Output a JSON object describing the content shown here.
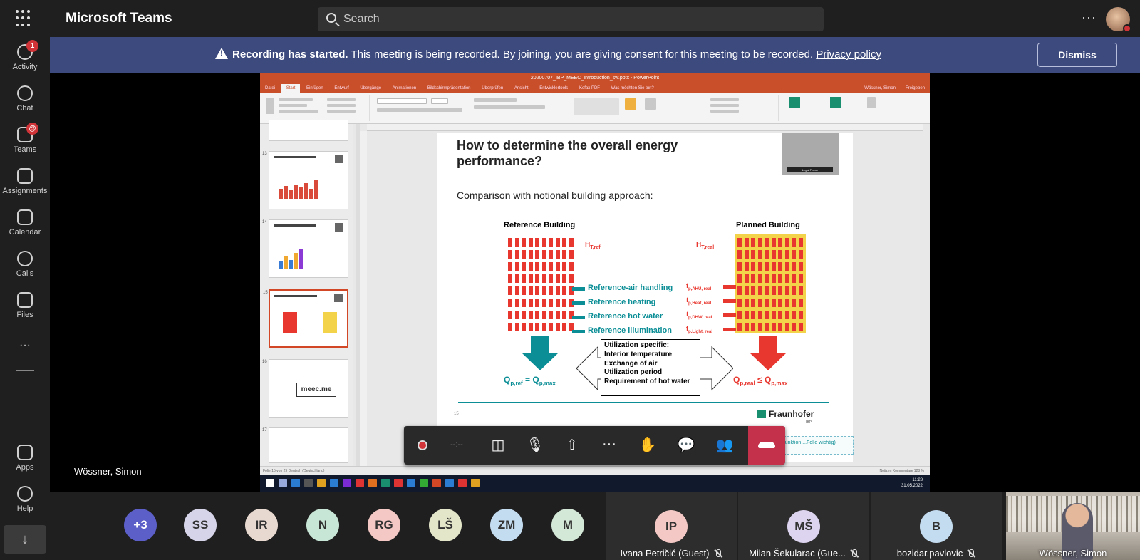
{
  "app": {
    "title": "Microsoft Teams"
  },
  "search": {
    "placeholder": "Search"
  },
  "top_right": {
    "more": "···"
  },
  "rail": {
    "items": [
      {
        "label": "Activity",
        "badge": "1",
        "icon": "bell-icon"
      },
      {
        "label": "Chat",
        "badge": "",
        "icon": "chat-icon"
      },
      {
        "label": "Teams",
        "badge": "@",
        "icon": "teams-icon"
      },
      {
        "label": "Assignments",
        "badge": "",
        "icon": "backpack-icon"
      },
      {
        "label": "Calendar",
        "badge": "",
        "icon": "calendar-icon"
      },
      {
        "label": "Calls",
        "badge": "",
        "icon": "phone-icon"
      },
      {
        "label": "Files",
        "badge": "",
        "icon": "file-icon"
      }
    ],
    "more": "···",
    "apps": "Apps",
    "help": "Help",
    "download": "↓"
  },
  "banner": {
    "bold": "Recording has started.",
    "text": " This meeting is being recorded. By joining, you are giving consent for this meeting to be recorded. ",
    "link": "Privacy policy",
    "dismiss": "Dismiss",
    "color": "#3d4a7d"
  },
  "speaker": {
    "name": "Wössner, Simon"
  },
  "ppt": {
    "window_title": "20200707_IBP_MEEC_Introduction_sw.pptx - PowerPoint",
    "tabs": [
      "Datei",
      "Start",
      "Einfügen",
      "Entwurf",
      "Übergänge",
      "Animationen",
      "Bildschirmpräsentation",
      "Überprüfen",
      "Ansicht",
      "Entwicklertools",
      "Kofax PDF",
      "Was möchten Sie tun?"
    ],
    "active_tab": "Start",
    "user": "Wössner, Simon",
    "share": "Freigeben",
    "thumb_numbers": [
      "13",
      "14",
      "15",
      "16",
      "17"
    ],
    "thumb_16_text": "meec.me",
    "slide": {
      "title": "How to determine the overall energy performance?",
      "subtitle": "Comparison with notional building approach:",
      "reference_label": "Reference Building",
      "planned_label": "Planned Building",
      "h_ref": "H",
      "h_ref_sub": "T,ref",
      "h_real": "H",
      "h_real_sub": "T,real",
      "ref_items": [
        "Reference-air handling",
        "Reference heating",
        "Reference  hot water",
        "Reference illumination"
      ],
      "f_items": [
        {
          "main": "f",
          "sub": "p,AHU, real"
        },
        {
          "main": "f",
          "sub": "p,Heat, real"
        },
        {
          "main": "f",
          "sub": "p,DHW, real"
        },
        {
          "main": "f",
          "sub": "p,Light, real"
        }
      ],
      "util_title": "Utilization specific:",
      "util_lines": [
        "Interior temperature",
        "Exchange of air",
        "Utilization period",
        "Requirement of hot water"
      ],
      "q_ref": "Q",
      "q_ref_sub": "p,ref",
      "q_ref_eq": " = Q",
      "q_ref_max": "p,max",
      "q_real": "Q",
      "q_real_sub": "p,real",
      "q_real_le": " ≤ Q",
      "q_real_max": "p,max",
      "page": "15",
      "logo": "Fraunhofer",
      "logo_sub": "IBP",
      "legal_cap": "Legal Frame"
    },
    "notes": "...d löschen (ist für die Funktion ...Folie wichtig)",
    "status": "Folie 15 von 29    Deutsch (Deutschland)",
    "status_right": "Notizen   Kommentare   128 %",
    "clock_time": "11:28",
    "clock_date": "31.05.2022"
  },
  "controls": {
    "timer": "--:--",
    "items": [
      {
        "name": "camera-off",
        "glyph": "◫"
      },
      {
        "name": "mic-off",
        "glyph": "🎙"
      },
      {
        "name": "share-tray",
        "glyph": "⇧"
      },
      {
        "name": "more-actions",
        "glyph": "···"
      },
      {
        "name": "raise-hand",
        "glyph": "✋"
      },
      {
        "name": "chat",
        "glyph": "💬"
      },
      {
        "name": "participants",
        "glyph": "👥"
      }
    ],
    "hangup_color": "#c4314b"
  },
  "participants": {
    "bubbles": [
      {
        "initials": "+3",
        "color": "#5b5fc7"
      },
      {
        "initials": "SS",
        "color": "#d6d4e8"
      },
      {
        "initials": "IR",
        "color": "#e8d9d0"
      },
      {
        "initials": "N",
        "color": "#c8e6d6"
      },
      {
        "initials": "RG",
        "color": "#f4c8c4"
      },
      {
        "initials": "LŠ",
        "color": "#e3e6c8"
      },
      {
        "initials": "ZM",
        "color": "#c4dcf0"
      },
      {
        "initials": "M",
        "color": "#d4e8d8"
      }
    ],
    "tiles": [
      {
        "initials": "IP",
        "name": "Ivana Petričić (Guest)",
        "color": "#f4c8c4"
      },
      {
        "initials": "MŠ",
        "name": "Milan Šekularac (Gue...",
        "color": "#ddd4f0"
      },
      {
        "initials": "B",
        "name": "bozidar.pavlovic",
        "color": "#c4dcf0"
      }
    ],
    "video": {
      "name": "Wössner, Simon"
    }
  }
}
